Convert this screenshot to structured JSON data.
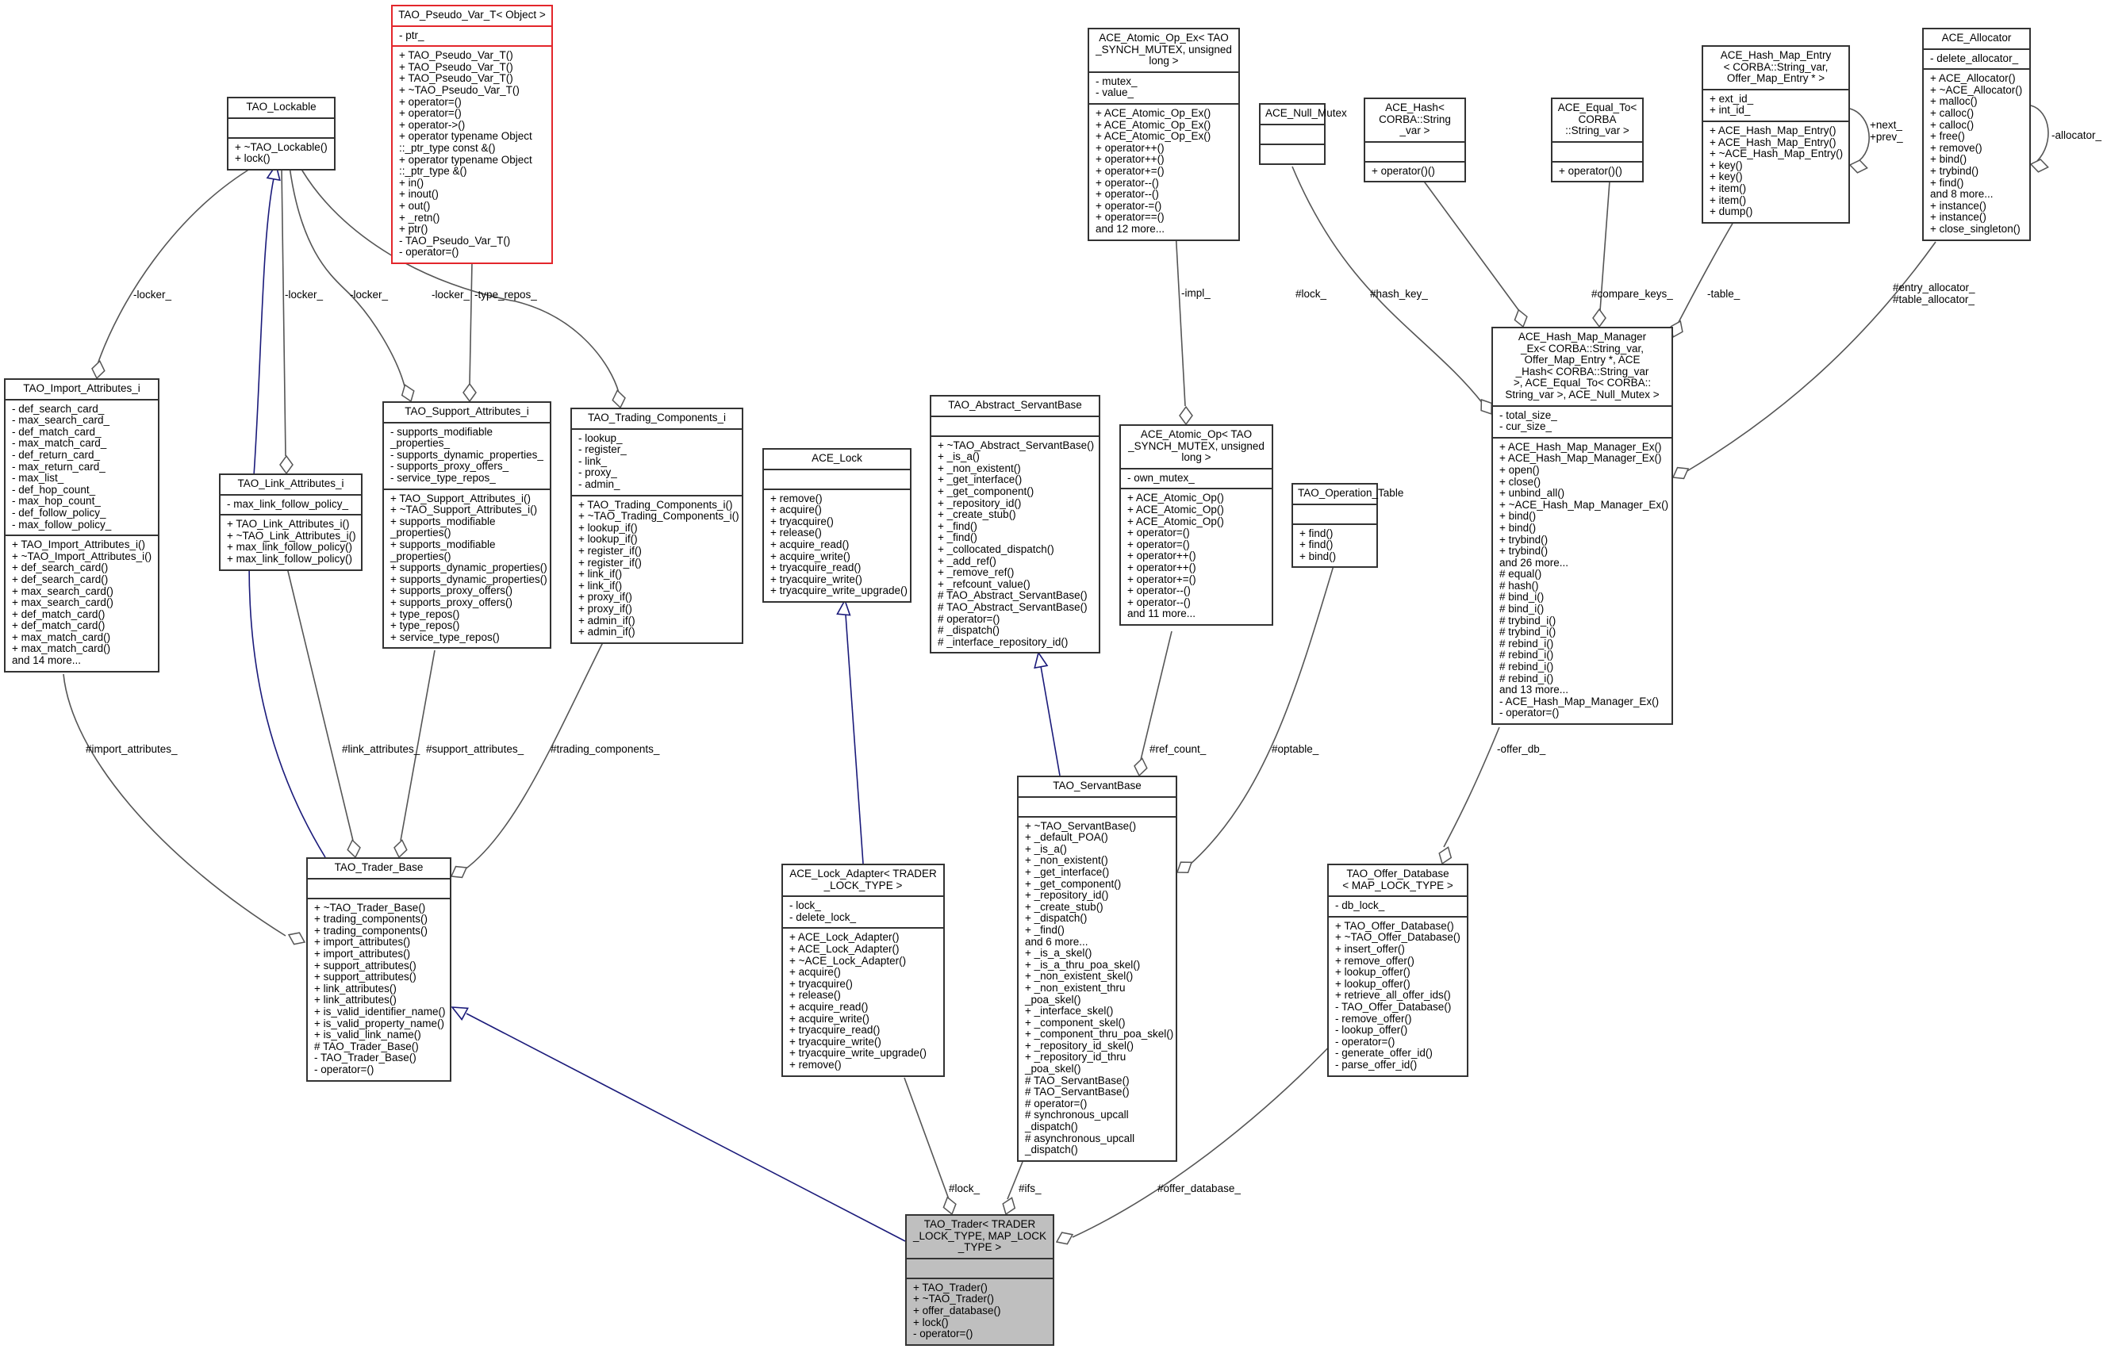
{
  "diagram": {
    "type": "doxygen-collaboration-graph",
    "focus_class": "TAO_Trader< TRADER _LOCK_TYPE, MAP_LOCK _TYPE >",
    "colors": {
      "box_border": "#333333",
      "focus_fill": "#bfbfbf",
      "template_border": "#e3262b",
      "inheritance_edge": "#1a1a7a",
      "usage_edge": "#555555"
    }
  },
  "classes": {
    "pseudo_var": {
      "title": "TAO_Pseudo_Var_T< Object >",
      "attributes": [
        "- ptr_"
      ],
      "methods": [
        "+ TAO_Pseudo_Var_T()",
        "+ TAO_Pseudo_Var_T()",
        "+ TAO_Pseudo_Var_T()",
        "+ ~TAO_Pseudo_Var_T()",
        "+ operator=()",
        "+ operator=()",
        "+ operator->()",
        "+ operator typename Object",
        "::_ptr_type const &()",
        "+ operator typename Object",
        "::_ptr_type &()",
        "+ in()",
        "+ inout()",
        "+ out()",
        "+ _retn()",
        "+ ptr()",
        "- TAO_Pseudo_Var_T()",
        "- operator=()"
      ]
    },
    "lockable": {
      "title": "TAO_Lockable",
      "attributes": [],
      "methods": [
        "+ ~TAO_Lockable()",
        "+ lock()"
      ]
    },
    "import_attrs": {
      "title": "TAO_Import_Attributes_i",
      "attributes": [
        "- def_search_card_",
        "- max_search_card_",
        "- def_match_card_",
        "- max_match_card_",
        "- def_return_card_",
        "- max_return_card_",
        "- max_list_",
        "- def_hop_count_",
        "- max_hop_count_",
        "- def_follow_policy_",
        "- max_follow_policy_"
      ],
      "methods": [
        "+ TAO_Import_Attributes_i()",
        "+ ~TAO_Import_Attributes_i()",
        "+ def_search_card()",
        "+ def_search_card()",
        "+ max_search_card()",
        "+ max_search_card()",
        "+ def_match_card()",
        "+ def_match_card()",
        "+ max_match_card()",
        "+ max_match_card()",
        "and 14 more..."
      ]
    },
    "link_attrs": {
      "title": "TAO_Link_Attributes_i",
      "attributes": [
        "- max_link_follow_policy_"
      ],
      "methods": [
        "+ TAO_Link_Attributes_i()",
        "+ ~TAO_Link_Attributes_i()",
        "+ max_link_follow_policy()",
        "+ max_link_follow_policy()"
      ]
    },
    "support_attrs": {
      "title": "TAO_Support_Attributes_i",
      "attributes": [
        "- supports_modifiable",
        "_properties_",
        "- supports_dynamic_properties_",
        "- supports_proxy_offers_",
        "- service_type_repos_"
      ],
      "methods": [
        "+ TAO_Support_Attributes_i()",
        "+ ~TAO_Support_Attributes_i()",
        "+ supports_modifiable",
        "_properties()",
        "+ supports_modifiable",
        "_properties()",
        "+ supports_dynamic_properties()",
        "+ supports_dynamic_properties()",
        "+ supports_proxy_offers()",
        "+ supports_proxy_offers()",
        "+ type_repos()",
        "+ type_repos()",
        "+ service_type_repos()"
      ]
    },
    "trading_comps": {
      "title": "TAO_Trading_Components_i",
      "attributes": [
        "- lookup_",
        "- register_",
        "- link_",
        "- proxy_",
        "- admin_"
      ],
      "methods": [
        "+ TAO_Trading_Components_i()",
        "+ ~TAO_Trading_Components_i()",
        "+ lookup_if()",
        "+ lookup_if()",
        "+ register_if()",
        "+ register_if()",
        "+ link_if()",
        "+ link_if()",
        "+ proxy_if()",
        "+ proxy_if()",
        "+ admin_if()",
        "+ admin_if()"
      ]
    },
    "ace_lock": {
      "title": "ACE_Lock",
      "attributes": [],
      "methods": [
        "+ remove()",
        "+ acquire()",
        "+ tryacquire()",
        "+ release()",
        "+ acquire_read()",
        "+ acquire_write()",
        "+ tryacquire_read()",
        "+ tryacquire_write()",
        "+ tryacquire_write_upgrade()"
      ]
    },
    "abstract_servant": {
      "title": "TAO_Abstract_ServantBase",
      "attributes": [],
      "methods": [
        "+ ~TAO_Abstract_ServantBase()",
        "+ _is_a()",
        "+ _non_existent()",
        "+ _get_interface()",
        "+ _get_component()",
        "+ _repository_id()",
        "+ _create_stub()",
        "+ _find()",
        "+ _find()",
        "+ _collocated_dispatch()",
        "+ _add_ref()",
        "+ _remove_ref()",
        "+ _refcount_value()",
        "# TAO_Abstract_ServantBase()",
        "# TAO_Abstract_ServantBase()",
        "# operator=()",
        "# _dispatch()",
        "# _interface_repository_id()"
      ]
    },
    "atomic_op_ex": {
      "title": "ACE_Atomic_Op_Ex< TAO\n_SYNCH_MUTEX, unsigned\nlong >",
      "attributes": [
        "- mutex_",
        "- value_"
      ],
      "methods": [
        "+ ACE_Atomic_Op_Ex()",
        "+ ACE_Atomic_Op_Ex()",
        "+ ACE_Atomic_Op_Ex()",
        "+ operator++()",
        "+ operator++()",
        "+ operator+=()",
        "+ operator--()",
        "+ operator--()",
        "+ operator-=()",
        "+ operator==()",
        "and 12 more..."
      ]
    },
    "atomic_op": {
      "title": "ACE_Atomic_Op< TAO\n_SYNCH_MUTEX, unsigned\nlong >",
      "attributes": [
        "- own_mutex_"
      ],
      "methods": [
        "+ ACE_Atomic_Op()",
        "+ ACE_Atomic_Op()",
        "+ ACE_Atomic_Op()",
        "+ operator=()",
        "+ operator=()",
        "+ operator++()",
        "+ operator++()",
        "+ operator+=()",
        "+ operator--()",
        "+ operator--()",
        "and 11 more..."
      ]
    },
    "null_mutex": {
      "title": "ACE_Null_Mutex",
      "attributes": [],
      "methods": []
    },
    "ace_hash": {
      "title": "ACE_Hash< CORBA::String\n_var >",
      "attributes": [],
      "methods": [
        "+ operator()()"
      ]
    },
    "ace_equal_to": {
      "title": "ACE_Equal_To< CORBA\n::String_var >",
      "attributes": [],
      "methods": [
        "+ operator()()"
      ]
    },
    "hash_map_entry": {
      "title": "ACE_Hash_Map_Entry\n< CORBA::String_var,\nOffer_Map_Entry * >",
      "attributes": [
        "+ ext_id_",
        "+ int_id_"
      ],
      "methods": [
        "+ ACE_Hash_Map_Entry()",
        "+ ACE_Hash_Map_Entry()",
        "+ ~ACE_Hash_Map_Entry()",
        "+ key()",
        "+ key()",
        "+ item()",
        "+ item()",
        "+ dump()"
      ]
    },
    "allocator": {
      "title": "ACE_Allocator",
      "attributes": [
        "- delete_allocator_"
      ],
      "methods": [
        "+ ACE_Allocator()",
        "+ ~ACE_Allocator()",
        "+ malloc()",
        "+ calloc()",
        "+ calloc()",
        "+ free()",
        "+ remove()",
        "+ bind()",
        "+ trybind()",
        "+ find()",
        "and 8 more...",
        "+ instance()",
        "+ instance()",
        "+ close_singleton()"
      ]
    },
    "hash_map_manager": {
      "title": "ACE_Hash_Map_Manager\n_Ex< CORBA::String_var,\nOffer_Map_Entry *, ACE\n_Hash< CORBA::String_var\n>, ACE_Equal_To< CORBA::\nString_var >, ACE_Null_Mutex >",
      "attributes": [
        "- total_size_",
        "- cur_size_"
      ],
      "methods": [
        "+ ACE_Hash_Map_Manager_Ex()",
        "+ ACE_Hash_Map_Manager_Ex()",
        "+ open()",
        "+ close()",
        "+ unbind_all()",
        "+ ~ACE_Hash_Map_Manager_Ex()",
        "+ bind()",
        "+ bind()",
        "+ trybind()",
        "+ trybind()",
        "and 26 more...",
        "# equal()",
        "# hash()",
        "# bind_i()",
        "# bind_i()",
        "# trybind_i()",
        "# trybind_i()",
        "# rebind_i()",
        "# rebind_i()",
        "# rebind_i()",
        "# rebind_i()",
        "and 13 more...",
        "- ACE_Hash_Map_Manager_Ex()",
        "- operator=()"
      ]
    },
    "operation_table": {
      "title": "TAO_Operation_Table",
      "attributes": [],
      "methods": [
        "+ find()",
        "+ find()",
        "+ bind()"
      ]
    },
    "servant_base": {
      "title": "TAO_ServantBase",
      "attributes": [],
      "methods": [
        "+ ~TAO_ServantBase()",
        "+ _default_POA()",
        "+ _is_a()",
        "+ _non_existent()",
        "+ _get_interface()",
        "+ _get_component()",
        "+ _repository_id()",
        "+ _create_stub()",
        "+ _dispatch()",
        "+ _find()",
        "and 6 more...",
        "+ _is_a_skel()",
        "+ _is_a_thru_poa_skel()",
        "+ _non_existent_skel()",
        "+ _non_existent_thru",
        "_poa_skel()",
        "+ _interface_skel()",
        "+ _component_skel()",
        "+ _component_thru_poa_skel()",
        "+ _repository_id_skel()",
        "+ _repository_id_thru",
        "_poa_skel()",
        "# TAO_ServantBase()",
        "# TAO_ServantBase()",
        "# operator=()",
        "# synchronous_upcall",
        "_dispatch()",
        "# asynchronous_upcall",
        "_dispatch()"
      ]
    },
    "trader_base": {
      "title": "TAO_Trader_Base",
      "attributes": [],
      "methods": [
        "+ ~TAO_Trader_Base()",
        "+ trading_components()",
        "+ trading_components()",
        "+ import_attributes()",
        "+ import_attributes()",
        "+ support_attributes()",
        "+ support_attributes()",
        "+ link_attributes()",
        "+ link_attributes()",
        "+ is_valid_identifier_name()",
        "+ is_valid_property_name()",
        "+ is_valid_link_name()",
        "# TAO_Trader_Base()",
        "- TAO_Trader_Base()",
        "- operator=()"
      ]
    },
    "lock_adapter": {
      "title": "ACE_Lock_Adapter< TRADER\n_LOCK_TYPE >",
      "attributes": [
        "- lock_",
        "- delete_lock_"
      ],
      "methods": [
        "+ ACE_Lock_Adapter()",
        "+ ACE_Lock_Adapter()",
        "+ ~ACE_Lock_Adapter()",
        "+ acquire()",
        "+ tryacquire()",
        "+ release()",
        "+ acquire_read()",
        "+ acquire_write()",
        "+ tryacquire_read()",
        "+ tryacquire_write()",
        "+ tryacquire_write_upgrade()",
        "+ remove()"
      ]
    },
    "offer_database": {
      "title": "TAO_Offer_Database\n< MAP_LOCK_TYPE >",
      "attributes": [
        "- db_lock_"
      ],
      "methods": [
        "+ TAO_Offer_Database()",
        "+ ~TAO_Offer_Database()",
        "+ insert_offer()",
        "+ remove_offer()",
        "+ lookup_offer()",
        "+ lookup_offer()",
        "+ retrieve_all_offer_ids()",
        "- TAO_Offer_Database()",
        "- remove_offer()",
        "- lookup_offer()",
        "- operator=()",
        "- generate_offer_id()",
        "- parse_offer_id()"
      ]
    },
    "trader": {
      "title": "TAO_Trader< TRADER\n_LOCK_TYPE, MAP_LOCK\n_TYPE >",
      "attributes": [],
      "methods": [
        "+ TAO_Trader()",
        "+ ~TAO_Trader()",
        "+ offer_database()",
        "+ lock()",
        "- operator=()"
      ]
    }
  },
  "edge_labels": {
    "locker_import": "-locker_",
    "locker_link": "-locker_",
    "locker_support": "-locker_",
    "locker_trading": "-locker_",
    "type_repos": "-type_repos_",
    "impl": "-impl_",
    "lock_null": "#lock_",
    "hash_key": "#hash_key_",
    "compare_keys": "#compare_keys_",
    "table": "-table_",
    "next_prev": "+next_\n+prev_",
    "allocator_self": "-allocator_",
    "entry_table_alloc": "#entry_allocator_\n#table_allocator_",
    "import_attributes": "#import_attributes_",
    "link_attributes": "#link_attributes_",
    "support_attributes": "#support_attributes_",
    "trading_components": "#trading_components_",
    "ref_count": "#ref_count_",
    "optable": "#optable_",
    "offer_db": "-offer_db_",
    "lock_trader": "#lock_",
    "ifs": "#ifs_",
    "offer_database": "#offer_database_"
  }
}
